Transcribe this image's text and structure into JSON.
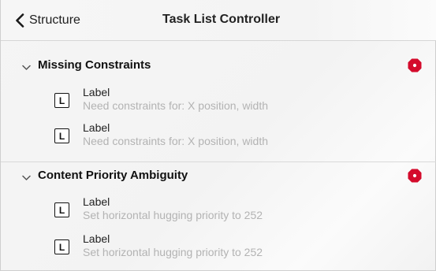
{
  "nav": {
    "back_label": "Structure",
    "title": "Task List Controller"
  },
  "colors": {
    "error_accent": "#d40b2c",
    "subtitle_gray": "#b3b3b3"
  },
  "sections": [
    {
      "title": "Missing Constraints",
      "icon": "error-stop-icon",
      "items": [
        {
          "badge": "L",
          "title": "Label",
          "subtitle": "Need constraints for: X position, width"
        },
        {
          "badge": "L",
          "title": "Label",
          "subtitle": "Need constraints for: X position, width"
        }
      ]
    },
    {
      "title": "Content Priority Ambiguity",
      "icon": "error-stop-icon",
      "items": [
        {
          "badge": "L",
          "title": "Label",
          "subtitle": "Set horizontal hugging priority to 252"
        },
        {
          "badge": "L",
          "title": "Label",
          "subtitle": "Set horizontal hugging priority to 252"
        }
      ]
    }
  ]
}
